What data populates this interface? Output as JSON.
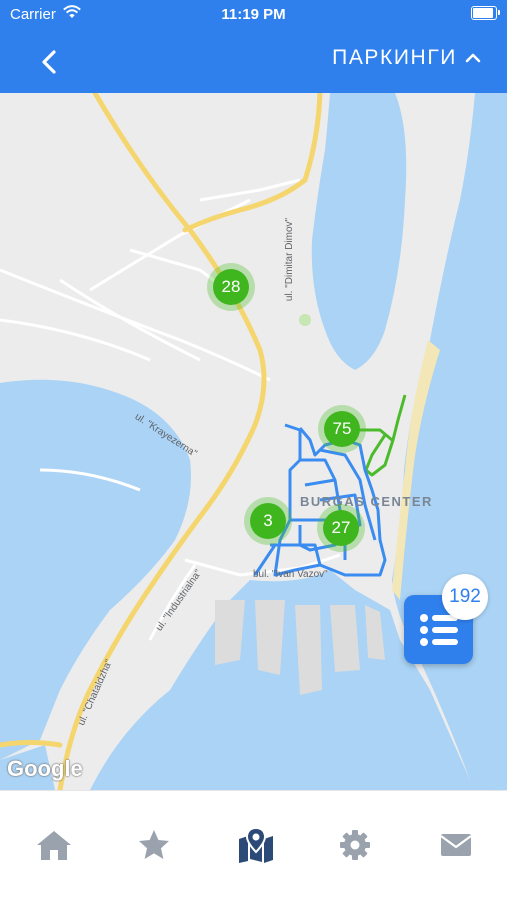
{
  "status": {
    "carrier": "Carrier",
    "time": "11:19 PM"
  },
  "header": {
    "title": "ПАРКИНГИ"
  },
  "map": {
    "clusters": [
      {
        "count": "28"
      },
      {
        "count": "75"
      },
      {
        "count": "3"
      },
      {
        "count": "27"
      }
    ],
    "labels": {
      "dimitar_dimov": "ul. \"Dimitar Dimov\"",
      "krayezerna": "ul. \"Krayezerna\"",
      "industrialna": "ul. \"Industrialna\"",
      "chataldzha": "ul. \"Chataldzha\"",
      "ivan_vazov": "bul. \"Ivan Vazov\"",
      "burgas_center": "BURGAS CENTER"
    },
    "attribution": "Google"
  },
  "list_fab": {
    "count": "192"
  },
  "tabs": [
    {
      "name": "home",
      "icon": "home-icon",
      "active": false
    },
    {
      "name": "favorites",
      "icon": "star-icon",
      "active": false
    },
    {
      "name": "map",
      "icon": "map-pin-icon",
      "active": true
    },
    {
      "name": "settings",
      "icon": "gear-icon",
      "active": false
    },
    {
      "name": "messages",
      "icon": "mail-icon",
      "active": false
    }
  ],
  "colors": {
    "primary": "#2f80ed",
    "cluster": "#3fb61e",
    "tab_inactive": "#9aa3ad",
    "tab_active": "#2c4a78",
    "water": "#aad3f5",
    "road_major": "#f5d66e"
  }
}
